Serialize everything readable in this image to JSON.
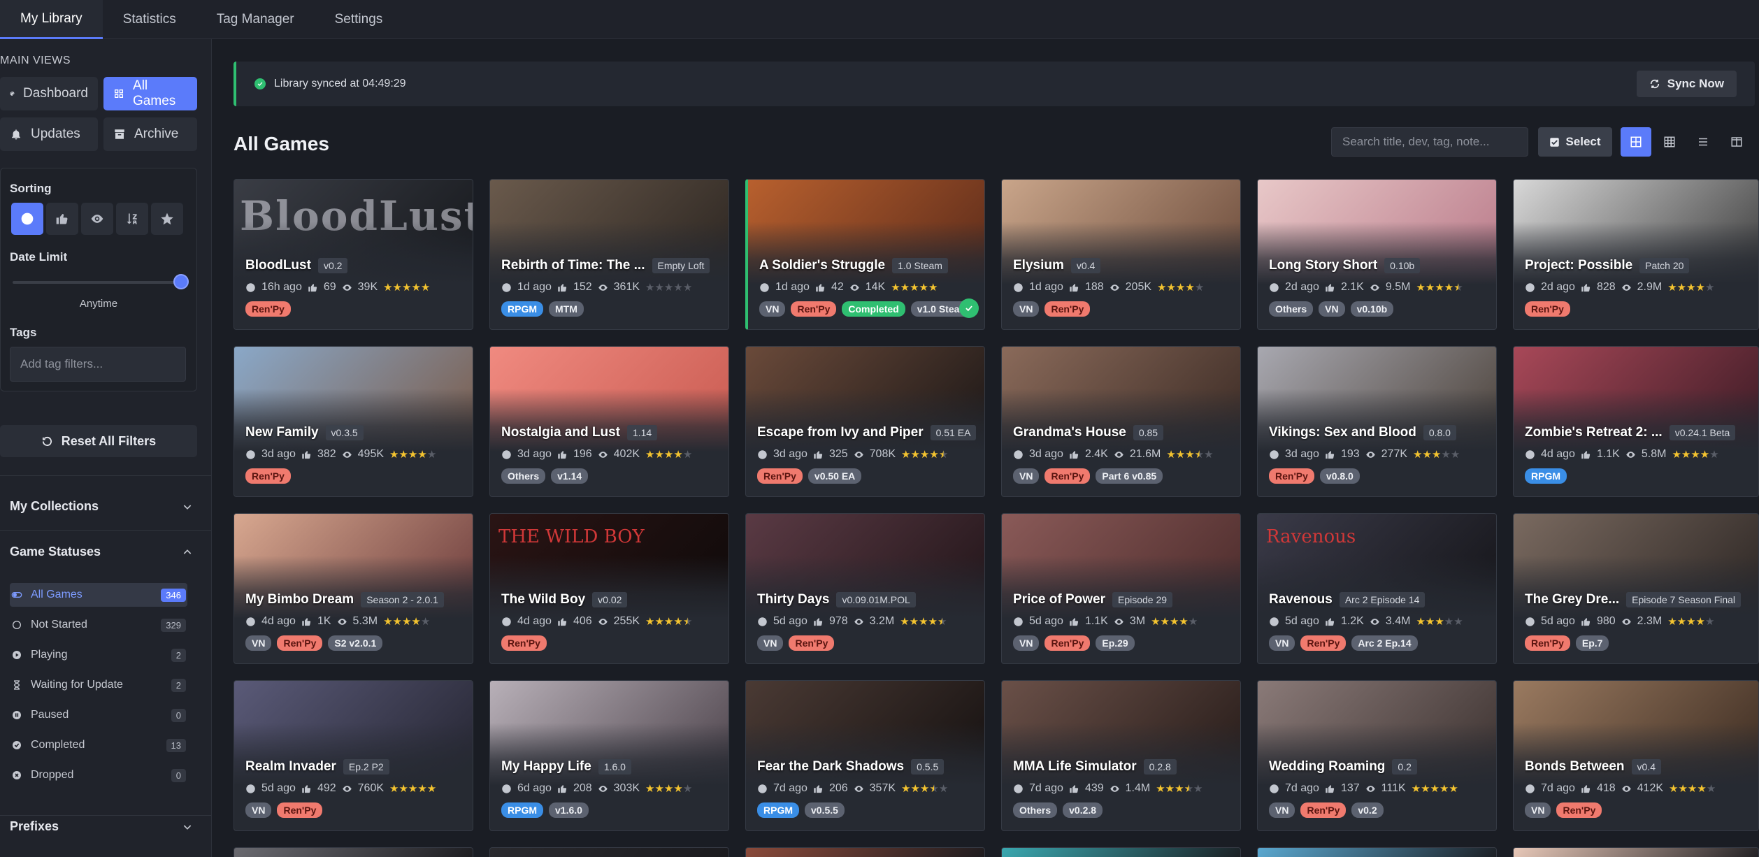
{
  "tabs": [
    {
      "label": "My Library",
      "active": true
    },
    {
      "label": "Statistics",
      "active": false
    },
    {
      "label": "Tag Manager",
      "active": false
    },
    {
      "label": "Settings",
      "active": false
    }
  ],
  "sidebar": {
    "main_views_title": "MAIN VIEWS",
    "views": [
      {
        "label": "Dashboard",
        "icon": "palette-icon",
        "active": false
      },
      {
        "label": "All Games",
        "icon": "grid-icon",
        "active": true
      },
      {
        "label": "Updates",
        "icon": "bell-icon",
        "active": false
      },
      {
        "label": "Archive",
        "icon": "archive-icon",
        "active": false
      }
    ],
    "sorting_label": "Sorting",
    "sort_options": [
      {
        "icon": "clock-icon",
        "active": true
      },
      {
        "icon": "thumbs-up-icon",
        "active": false
      },
      {
        "icon": "eye-icon",
        "active": false
      },
      {
        "icon": "sort-alpha-icon",
        "active": false
      },
      {
        "icon": "star-icon",
        "active": false
      }
    ],
    "date_limit_label": "Date Limit",
    "date_limit_value": "Anytime",
    "date_limit_fraction": 1.0,
    "tags_label": "Tags",
    "tag_filter_placeholder": "Add tag filters...",
    "reset_label": "Reset All Filters",
    "collections_label": "My Collections",
    "statuses_label": "Game Statuses",
    "statuses": [
      {
        "label": "All Games",
        "count": "346",
        "icon": "toggle-icon",
        "active": true
      },
      {
        "label": "Not Started",
        "count": "329",
        "icon": "circle-icon",
        "active": false
      },
      {
        "label": "Playing",
        "count": "2",
        "icon": "play-icon",
        "active": false
      },
      {
        "label": "Waiting for Update",
        "count": "2",
        "icon": "hourglass-icon",
        "active": false
      },
      {
        "label": "Paused",
        "count": "0",
        "icon": "pause-icon",
        "active": false
      },
      {
        "label": "Completed",
        "count": "13",
        "icon": "check-circle-icon",
        "active": false
      },
      {
        "label": "Dropped",
        "count": "0",
        "icon": "x-circle-icon",
        "active": false
      }
    ],
    "prefixes_label": "Prefixes"
  },
  "main": {
    "sync_message": "Library synced at 04:49:29",
    "sync_button": "Sync Now",
    "title": "All Games",
    "search_placeholder": "Search title, dev, tag, note...",
    "select_label": "Select",
    "view_modes": [
      "grid-large-icon",
      "grid-small-icon",
      "list-icon",
      "columns-icon"
    ]
  },
  "colors": {
    "accent": "#5b7bfa",
    "renpy_tag": "#f07a6e",
    "rpgm_tag": "#3a8ee6",
    "completed": "#2fbf71",
    "star": "#f4c430"
  },
  "games": [
    {
      "title": "BloodLust",
      "version": "v0.2",
      "age": "16h ago",
      "likes": "69",
      "views": "39K",
      "rating": 5,
      "tags": [
        {
          "t": "Ren'Py",
          "c": "renpy"
        }
      ],
      "art": [
        "#3a3d45",
        "#15171b"
      ],
      "logo": "BloodLust"
    },
    {
      "title": "Rebirth of Time: The ...",
      "version": "Empty Loft",
      "age": "1d ago",
      "likes": "152",
      "views": "361K",
      "rating": 0,
      "tags": [
        {
          "t": "RPGM",
          "c": "blue"
        },
        {
          "t": "MTM",
          "c": "gray"
        }
      ],
      "art": [
        "#6a5a4c",
        "#2a2420"
      ]
    },
    {
      "title": "A Soldier's Struggle",
      "version": "1.0 Steam",
      "age": "1d ago",
      "likes": "42",
      "views": "14K",
      "rating": 5,
      "tags": [
        {
          "t": "VN",
          "c": "gray"
        },
        {
          "t": "Ren'Py",
          "c": "renpy"
        },
        {
          "t": "Completed",
          "c": "green"
        },
        {
          "t": "v1.0 Steam",
          "c": "gray"
        }
      ],
      "art": [
        "#b8602e",
        "#5a2a1a"
      ],
      "completed": true
    },
    {
      "title": "Elysium",
      "version": "v0.4",
      "age": "1d ago",
      "likes": "188",
      "views": "205K",
      "rating": 4,
      "tags": [
        {
          "t": "VN",
          "c": "gray"
        },
        {
          "t": "Ren'Py",
          "c": "renpy"
        }
      ],
      "art": [
        "#c9a58a",
        "#6a4a3a"
      ]
    },
    {
      "title": "Long Story Short",
      "version": "0.10b",
      "age": "2d ago",
      "likes": "2.1K",
      "views": "9.5M",
      "rating": 4.5,
      "tags": [
        {
          "t": "Others",
          "c": "gray"
        },
        {
          "t": "VN",
          "c": "gray"
        },
        {
          "t": "v0.10b",
          "c": "gray"
        }
      ],
      "art": [
        "#e8c8c8",
        "#b87888"
      ]
    },
    {
      "title": "Project: Possible",
      "version": "Patch 20",
      "age": "2d ago",
      "likes": "828",
      "views": "2.9M",
      "rating": 4,
      "tags": [
        {
          "t": "Ren'Py",
          "c": "renpy"
        }
      ],
      "art": [
        "#d8d8d8",
        "#3a3a3a"
      ]
    },
    {
      "title": "New Family",
      "version": "v0.3.5",
      "age": "3d ago",
      "likes": "382",
      "views": "495K",
      "rating": 4,
      "tags": [
        {
          "t": "Ren'Py",
          "c": "renpy"
        }
      ],
      "art": [
        "#8aa8c8",
        "#7a5a48"
      ]
    },
    {
      "title": "Nostalgia and Lust",
      "version": "1.14",
      "age": "3d ago",
      "likes": "196",
      "views": "402K",
      "rating": 4,
      "tags": [
        {
          "t": "Others",
          "c": "gray"
        },
        {
          "t": "v1.14",
          "c": "gray"
        }
      ],
      "art": [
        "#f08a80",
        "#c85a50"
      ]
    },
    {
      "title": "Escape from Ivy and Piper",
      "version": "0.51 EA",
      "age": "3d ago",
      "likes": "325",
      "views": "708K",
      "rating": 4.5,
      "tags": [
        {
          "t": "Ren'Py",
          "c": "renpy"
        },
        {
          "t": "v0.50 EA",
          "c": "gray"
        }
      ],
      "art": [
        "#6a4a3a",
        "#1a1616"
      ]
    },
    {
      "title": "Grandma's House",
      "version": "0.85",
      "age": "3d ago",
      "likes": "2.4K",
      "views": "21.6M",
      "rating": 3.5,
      "tags": [
        {
          "t": "VN",
          "c": "gray"
        },
        {
          "t": "Ren'Py",
          "c": "renpy"
        },
        {
          "t": "Part 6 v0.85",
          "c": "gray"
        }
      ],
      "art": [
        "#8a6a5a",
        "#3a2a24"
      ]
    },
    {
      "title": "Vikings: Sex and Blood",
      "version": "0.8.0",
      "age": "3d ago",
      "likes": "193",
      "views": "277K",
      "rating": 3,
      "tags": [
        {
          "t": "Ren'Py",
          "c": "renpy"
        },
        {
          "t": "v0.8.0",
          "c": "gray"
        }
      ],
      "art": [
        "#a8a8b0",
        "#4a4038"
      ]
    },
    {
      "title": "Zombie's Retreat 2: ...",
      "version": "v0.24.1 Beta",
      "age": "4d ago",
      "likes": "1.1K",
      "views": "5.8M",
      "rating": 4,
      "tags": [
        {
          "t": "RPGM",
          "c": "blue"
        }
      ],
      "art": [
        "#a84858",
        "#3a1a24"
      ]
    },
    {
      "title": "My Bimbo Dream",
      "version": "Season 2 - 2.0.1",
      "age": "4d ago",
      "likes": "1K",
      "views": "5.3M",
      "rating": 4,
      "tags": [
        {
          "t": "VN",
          "c": "gray"
        },
        {
          "t": "Ren'Py",
          "c": "renpy"
        },
        {
          "t": "S2 v2.0.1",
          "c": "gray"
        }
      ],
      "art": [
        "#d8a890",
        "#6a3a3a"
      ]
    },
    {
      "title": "The Wild Boy",
      "version": "v0.02",
      "age": "4d ago",
      "likes": "406",
      "views": "255K",
      "rating": 4.5,
      "tags": [
        {
          "t": "Ren'Py",
          "c": "renpy"
        }
      ],
      "art": [
        "#2a1414",
        "#0e0a0a"
      ],
      "logo_red": "THE WILD BOY"
    },
    {
      "title": "Thirty Days",
      "version": "v0.09.01M.POL",
      "age": "5d ago",
      "likes": "978",
      "views": "3.2M",
      "rating": 4.5,
      "tags": [
        {
          "t": "VN",
          "c": "gray"
        },
        {
          "t": "Ren'Py",
          "c": "renpy"
        }
      ],
      "art": [
        "#5a3a44",
        "#201418"
      ]
    },
    {
      "title": "Price of Power",
      "version": "Episode 29",
      "age": "5d ago",
      "likes": "1.1K",
      "views": "3M",
      "rating": 4,
      "tags": [
        {
          "t": "VN",
          "c": "gray"
        },
        {
          "t": "Ren'Py",
          "c": "renpy"
        },
        {
          "t": "Ep.29",
          "c": "gray"
        }
      ],
      "art": [
        "#8a5a58",
        "#4a2a2a"
      ]
    },
    {
      "title": "Ravenous",
      "version": "Arc 2 Episode 14",
      "age": "5d ago",
      "likes": "1.2K",
      "views": "3.4M",
      "rating": 3,
      "tags": [
        {
          "t": "VN",
          "c": "gray"
        },
        {
          "t": "Ren'Py",
          "c": "renpy"
        },
        {
          "t": "Arc 2 Ep.14",
          "c": "gray"
        }
      ],
      "art": [
        "#3a3a48",
        "#141418"
      ],
      "logo_red": "Ravenous"
    },
    {
      "title": "The Grey Dre...",
      "version": "Episode 7 Season Final",
      "age": "5d ago",
      "likes": "980",
      "views": "2.3M",
      "rating": 4,
      "tags": [
        {
          "t": "Ren'Py",
          "c": "renpy"
        },
        {
          "t": "Ep.7",
          "c": "gray"
        }
      ],
      "art": [
        "#7a6a60",
        "#2a2422"
      ]
    },
    {
      "title": "Realm Invader",
      "version": "Ep.2 P2",
      "age": "5d ago",
      "likes": "492",
      "views": "760K",
      "rating": 5,
      "tags": [
        {
          "t": "VN",
          "c": "gray"
        },
        {
          "t": "Ren'Py",
          "c": "renpy"
        }
      ],
      "art": [
        "#5a5a78",
        "#242430"
      ]
    },
    {
      "title": "My Happy Life",
      "version": "1.6.0",
      "age": "6d ago",
      "likes": "208",
      "views": "303K",
      "rating": 4,
      "tags": [
        {
          "t": "RPGM",
          "c": "blue"
        },
        {
          "t": "v1.6.0",
          "c": "gray"
        }
      ],
      "art": [
        "#b8b0b8",
        "#4a4048"
      ]
    },
    {
      "title": "Fear the Dark Shadows",
      "version": "0.5.5",
      "age": "7d ago",
      "likes": "206",
      "views": "357K",
      "rating": 3.5,
      "tags": [
        {
          "t": "RPGM",
          "c": "blue"
        },
        {
          "t": "v0.5.5",
          "c": "gray"
        }
      ],
      "art": [
        "#4a3a34",
        "#141010"
      ]
    },
    {
      "title": "MMA Life Simulator",
      "version": "0.2.8",
      "age": "7d ago",
      "likes": "439",
      "views": "1.4M",
      "rating": 3.5,
      "tags": [
        {
          "t": "Others",
          "c": "gray"
        },
        {
          "t": "v0.2.8",
          "c": "gray"
        }
      ],
      "art": [
        "#6a5048",
        "#241a18"
      ]
    },
    {
      "title": "Wedding Roaming",
      "version": "0.2",
      "age": "7d ago",
      "likes": "137",
      "views": "111K",
      "rating": 5,
      "tags": [
        {
          "t": "VN",
          "c": "gray"
        },
        {
          "t": "Ren'Py",
          "c": "renpy"
        },
        {
          "t": "v0.2",
          "c": "gray"
        }
      ],
      "art": [
        "#8a7a78",
        "#3a302e"
      ]
    },
    {
      "title": "Bonds Between",
      "version": "v0.4",
      "age": "7d ago",
      "likes": "418",
      "views": "412K",
      "rating": 4,
      "tags": [
        {
          "t": "VN",
          "c": "gray"
        },
        {
          "t": "Ren'Py",
          "c": "renpy"
        }
      ],
      "art": [
        "#9a7a60",
        "#3a2a20"
      ]
    }
  ],
  "stub_row_colors": [
    "#6a6a70",
    "#2a2a2e",
    "#8a4a3a",
    "#3aa8b0",
    "#5aa8d0",
    "#e8c8b8"
  ]
}
